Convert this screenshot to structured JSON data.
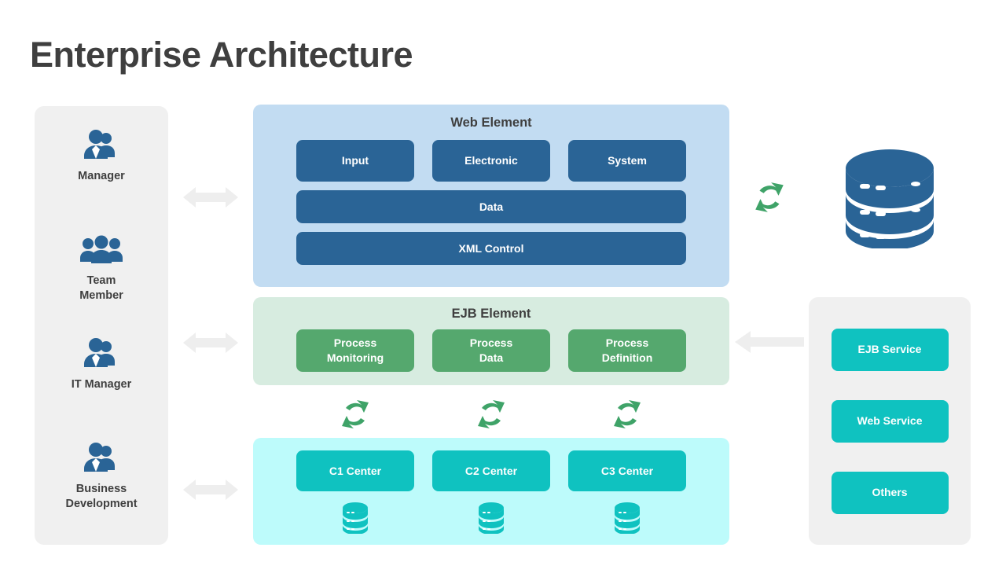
{
  "page": {
    "title": "Enterprise Architecture",
    "background": "#ffffff"
  },
  "colors": {
    "title_text": "#3f3f3f",
    "panel_gray": "#f0f0f0",
    "web_panel_bg": "#c2dcf2",
    "web_chip": "#2a6496",
    "ejb_panel_bg": "#d7ece0",
    "ejb_chip": "#55a86e",
    "center_panel_bg": "#bdfbfb",
    "center_chip": "#0fc2c0",
    "sync_green": "#3fa368",
    "arrow_gray": "#eeeeee",
    "icon_blue": "#2a6496"
  },
  "sidebar": {
    "roles": [
      {
        "label": "Manager",
        "icon": "people-group-icon"
      },
      {
        "label": "Team\nMember",
        "icon": "people-group-icon"
      },
      {
        "label": "IT Manager",
        "icon": "people-group-icon"
      },
      {
        "label": "Business\nDevelopment",
        "icon": "people-group-icon"
      }
    ]
  },
  "arrows": {
    "manager_arrow": "double-arrow-icon",
    "it_manager_arrow": "double-arrow-icon",
    "business_arrow": "double-arrow-icon",
    "services_to_ejb_arrow": "left-arrow-icon"
  },
  "web_element": {
    "title": "Web Element",
    "top_chips": [
      "Input",
      "Electronic",
      "System"
    ],
    "wide_chips": [
      "Data",
      "XML Control"
    ]
  },
  "ejb_element": {
    "title": "EJB Element",
    "chips": [
      "Process\nMonitoring",
      "Process\nData",
      "Process\nDefinition"
    ]
  },
  "sync_icons": {
    "between_ejb_and_center": [
      "sync-icon",
      "sync-icon",
      "sync-icon"
    ],
    "web_to_database": "sync-icon"
  },
  "center_element": {
    "chips": [
      "C1 Center",
      "C2 Center",
      "C3 Center"
    ],
    "databases": [
      "database-icon",
      "database-icon",
      "database-icon"
    ]
  },
  "right_side": {
    "database": "database-icon",
    "services": [
      "EJB Service",
      "Web Service",
      "Others"
    ]
  }
}
